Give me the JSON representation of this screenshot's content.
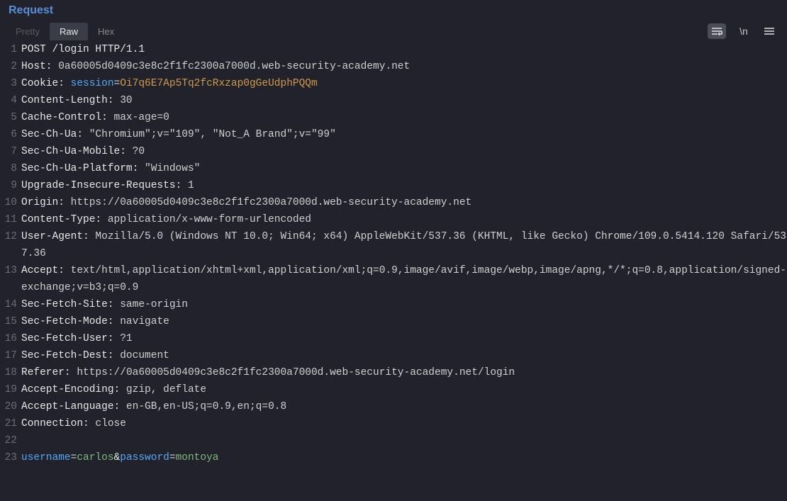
{
  "panel": {
    "title": "Request",
    "tabs": [
      {
        "label": "Pretty",
        "active": false,
        "disabled": true
      },
      {
        "label": "Raw",
        "active": true,
        "disabled": false
      },
      {
        "label": "Hex",
        "active": false,
        "disabled": false
      }
    ],
    "newlineLabel": "\\n"
  },
  "request": {
    "method": "POST",
    "path": "/login",
    "protocol": "HTTP/1.1",
    "host": "0a60005d0409c3e8c2f1fc2300a7000d.web-security-academy.net",
    "cookie": {
      "name": "session",
      "value": "Oi7q6E7Ap5Tq2fcRxzap0gGeUdphPQQm"
    },
    "headers": [
      {
        "name": "Content-Length",
        "value": "30"
      },
      {
        "name": "Cache-Control",
        "value": "max-age=0"
      },
      {
        "name": "Sec-Ch-Ua",
        "value": "\"Chromium\";v=\"109\", \"Not_A Brand\";v=\"99\""
      },
      {
        "name": "Sec-Ch-Ua-Mobile",
        "value": "?0"
      },
      {
        "name": "Sec-Ch-Ua-Platform",
        "value": "\"Windows\""
      },
      {
        "name": "Upgrade-Insecure-Requests",
        "value": "1"
      },
      {
        "name": "Origin",
        "value": "https://0a60005d0409c3e8c2f1fc2300a7000d.web-security-academy.net"
      },
      {
        "name": "Content-Type",
        "value": "application/x-www-form-urlencoded"
      },
      {
        "name": "User-Agent",
        "value": "Mozilla/5.0 (Windows NT 10.0; Win64; x64) AppleWebKit/537.36 (KHTML, like Gecko) Chrome/109.0.5414.120 Safari/537.36"
      },
      {
        "name": "Accept",
        "value": "text/html,application/xhtml+xml,application/xml;q=0.9,image/avif,image/webp,image/apng,*/*;q=0.8,application/signed-exchange;v=b3;q=0.9"
      },
      {
        "name": "Sec-Fetch-Site",
        "value": "same-origin"
      },
      {
        "name": "Sec-Fetch-Mode",
        "value": "navigate"
      },
      {
        "name": "Sec-Fetch-User",
        "value": "?1"
      },
      {
        "name": "Sec-Fetch-Dest",
        "value": "document"
      },
      {
        "name": "Referer",
        "value": "https://0a60005d0409c3e8c2f1fc2300a7000d.web-security-academy.net/login"
      },
      {
        "name": "Accept-Encoding",
        "value": "gzip, deflate"
      },
      {
        "name": "Accept-Language",
        "value": "en-GB,en-US;q=0.9,en;q=0.8"
      },
      {
        "name": "Connection",
        "value": "close"
      }
    ],
    "body": {
      "params": [
        {
          "name": "username",
          "value": "carlos"
        },
        {
          "name": "password",
          "value": "montoya"
        }
      ]
    }
  }
}
